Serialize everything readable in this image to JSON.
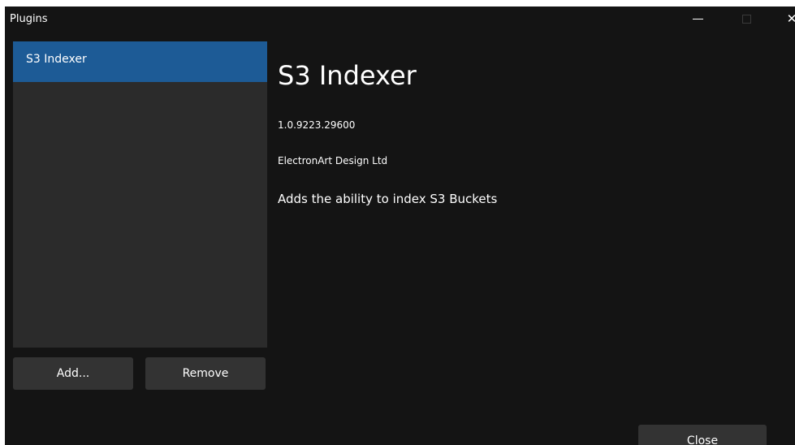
{
  "window": {
    "title": "Plugins",
    "close_glyph": "✕"
  },
  "plugin_list": {
    "items": [
      {
        "label": "S3 Indexer",
        "selected": true
      }
    ]
  },
  "details": {
    "name": "S3 Indexer",
    "version": "1.0.9223.29600",
    "author": "ElectronArt Design Ltd",
    "description": "Adds the ability to index S3 Buckets"
  },
  "buttons": {
    "add_label": "Add...",
    "remove_label": "Remove",
    "close_label": "Close"
  },
  "colors": {
    "background": "#141414",
    "list_background": "#2b2b2b",
    "selected_item": "#1d5b96",
    "button": "#333333"
  }
}
